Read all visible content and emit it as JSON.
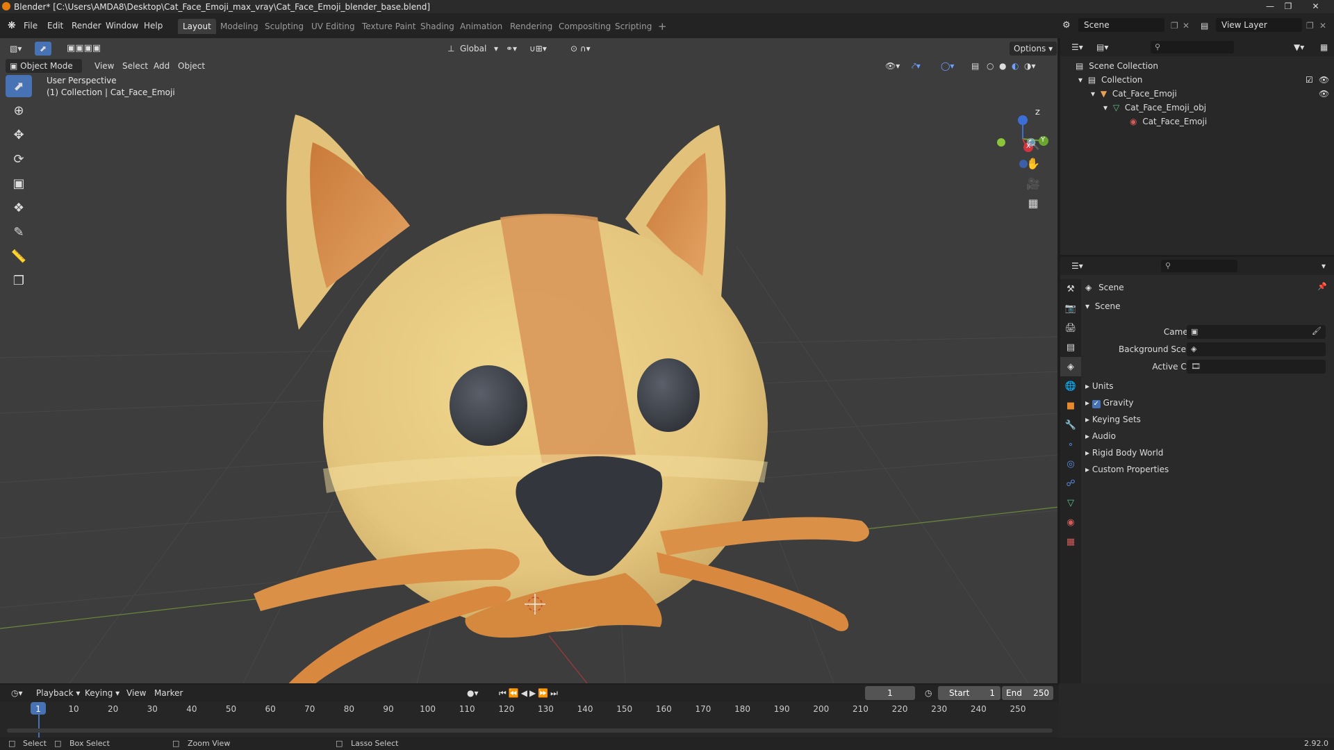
{
  "window": {
    "title": "Blender* [C:\\Users\\AMDA8\\Desktop\\Cat_Face_Emoji_max_vray\\Cat_Face_Emoji_blender_base.blend]"
  },
  "menu": {
    "file": "File",
    "edit": "Edit",
    "render": "Render",
    "window": "Window",
    "help": "Help"
  },
  "workspaces": [
    "Layout",
    "Modeling",
    "Sculpting",
    "UV Editing",
    "Texture Paint",
    "Shading",
    "Animation",
    "Rendering",
    "Compositing",
    "Scripting"
  ],
  "scene_name": "Scene",
  "view_layer": "View Layer",
  "viewport": {
    "mode": "Object Mode",
    "menus": [
      "View",
      "Select",
      "Add",
      "Object"
    ],
    "transform_orientation": "Global",
    "options_label": "Options",
    "perspective_label": "User Perspective",
    "collection_label": "(1) Collection | Cat_Face_Emoji",
    "gizmo_axes": {
      "x": "X",
      "y": "Y",
      "z": "Z"
    }
  },
  "outliner": {
    "root": "Scene Collection",
    "items": [
      {
        "label": "Collection",
        "icon": "collection-icon"
      },
      {
        "label": "Cat_Face_Emoji",
        "icon": "object-icon"
      },
      {
        "label": "Cat_Face_Emoji_obj",
        "icon": "mesh-icon"
      },
      {
        "label": "Cat_Face_Emoji",
        "icon": "material-icon"
      }
    ]
  },
  "properties": {
    "context": "Scene",
    "panel_title": "Scene",
    "camera_label": "Camera",
    "background_scene_label": "Background Scene",
    "active_clip_label": "Active Clip",
    "panels": [
      "Units",
      "Gravity",
      "Keying Sets",
      "Audio",
      "Rigid Body World",
      "Custom Properties"
    ],
    "gravity_checked": true
  },
  "timeline": {
    "menus": [
      "Playback",
      "Keying",
      "View",
      "Marker"
    ],
    "current_frame": "1",
    "start_label": "Start",
    "start_value": "1",
    "end_label": "End",
    "end_value": "250",
    "ticks": [
      "1",
      "10",
      "20",
      "30",
      "40",
      "50",
      "60",
      "70",
      "80",
      "90",
      "100",
      "110",
      "120",
      "130",
      "140",
      "150",
      "160",
      "170",
      "180",
      "190",
      "200",
      "210",
      "220",
      "230",
      "240",
      "250"
    ]
  },
  "statusbar": {
    "select": "Select",
    "box_select": "Box Select",
    "zoom_view": "Zoom View",
    "lasso_select": "Lasso Select",
    "version": "2.92.0"
  },
  "colors": {
    "accent": "#4772b3",
    "fur": "#e3c77f",
    "stripe": "#d9985a",
    "whisker": "#d98a43",
    "dark": "#3a3d44"
  }
}
